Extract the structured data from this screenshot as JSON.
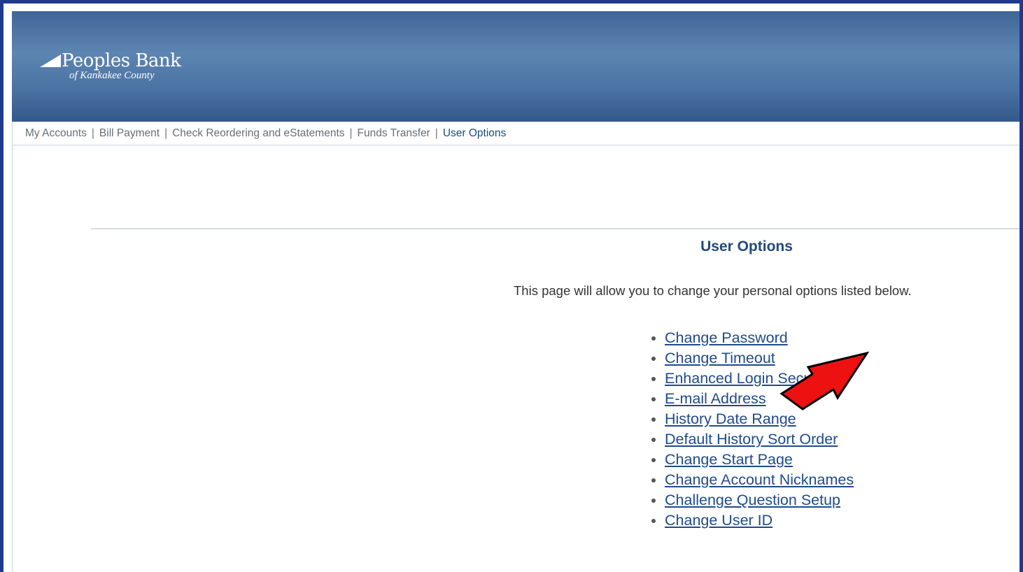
{
  "branding": {
    "name": "Peoples Bank",
    "subtitle": "of Kankakee County"
  },
  "nav": {
    "items": [
      {
        "label": "My Accounts",
        "active": false
      },
      {
        "label": "Bill Payment",
        "active": false
      },
      {
        "label": "Check Reordering and eStatements",
        "active": false
      },
      {
        "label": "Funds Transfer",
        "active": false
      },
      {
        "label": "User Options",
        "active": true
      }
    ],
    "separator": "|"
  },
  "main": {
    "title": "User Options",
    "intro": "This page will allow you to change your personal options listed below.",
    "options": [
      "Change Password",
      "Change Timeout",
      "Enhanced Login Security",
      "E-mail Address",
      "History Date Range",
      "Default History Sort Order",
      "Change Start Page",
      "Change Account Nicknames",
      "Challenge Question Setup",
      "Change User ID"
    ]
  },
  "annotation": {
    "icon": "red-arrow-icon",
    "color": "#ee1111",
    "target": "E-mail Address"
  },
  "colors": {
    "header": "#4b73a3",
    "frame": "#1f3a8f",
    "link": "#1f4b8a",
    "title": "#23497e"
  }
}
